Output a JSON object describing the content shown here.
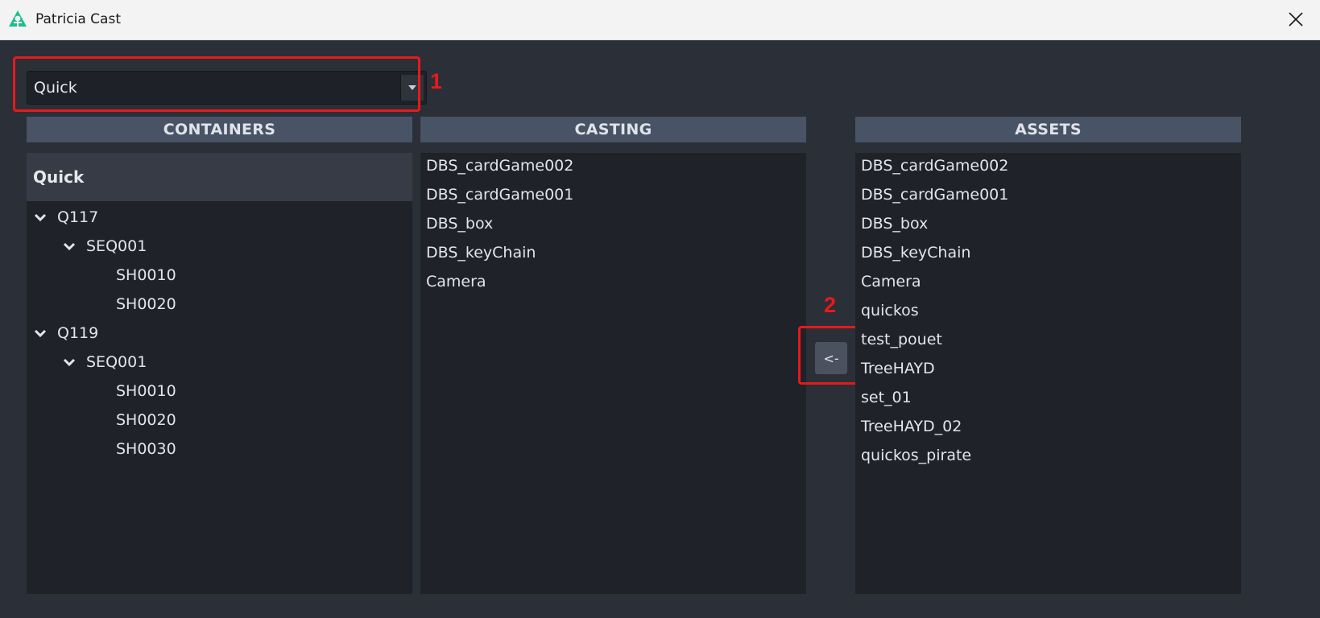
{
  "window": {
    "title": "Patricia Cast",
    "logo_icon": "patricia-tree-logo",
    "logo_color": "#1dbf8c",
    "close_icon": "close-x"
  },
  "selector": {
    "value": "Quick",
    "arrow_icon": "caret-down"
  },
  "annotations": {
    "marker_1": "1",
    "marker_2": "2",
    "color": "#e8191b"
  },
  "containers": {
    "header": "CONTAINERS",
    "root": "Quick",
    "tree": [
      {
        "label": "Q117",
        "expanded": true,
        "children": [
          {
            "label": "SEQ001",
            "expanded": true,
            "children": [
              {
                "label": "SH0010"
              },
              {
                "label": "SH0020"
              }
            ]
          }
        ]
      },
      {
        "label": "Q119",
        "expanded": true,
        "children": [
          {
            "label": "SEQ001",
            "expanded": true,
            "children": [
              {
                "label": "SH0010"
              },
              {
                "label": "SH0020"
              },
              {
                "label": "SH0030"
              }
            ]
          }
        ]
      }
    ]
  },
  "casting": {
    "header": "CASTING",
    "items": [
      "DBS_cardGame002",
      "DBS_cardGame001",
      "DBS_box",
      "DBS_keyChain",
      "Camera"
    ]
  },
  "assets": {
    "header": "ASSETS",
    "items": [
      "DBS_cardGame002",
      "DBS_cardGame001",
      "DBS_box",
      "DBS_keyChain",
      "Camera",
      "quickos",
      "test_pouet",
      "TreeHAYD",
      "set_01",
      "TreeHAYD_02",
      "quickos_pirate"
    ]
  },
  "move_button": {
    "label": "<-"
  }
}
